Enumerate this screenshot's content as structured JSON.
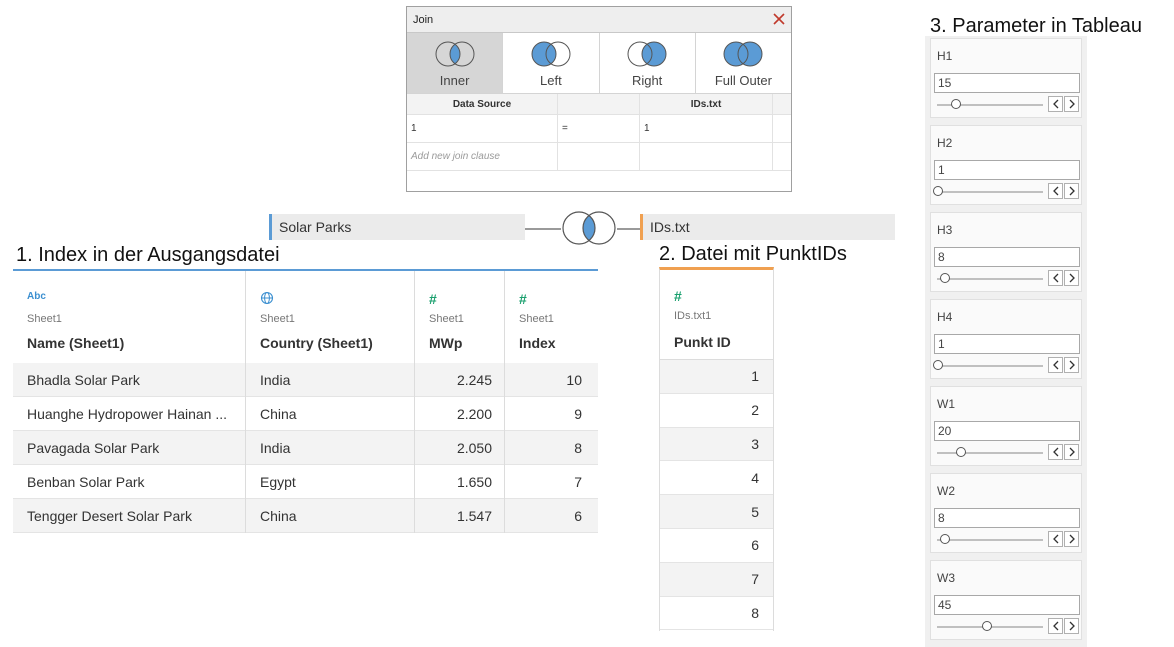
{
  "join_dialog": {
    "title": "Join",
    "types": [
      {
        "label": "Inner",
        "selected": true,
        "icon": "inner-join-icon"
      },
      {
        "label": "Left",
        "selected": false,
        "icon": "left-join-icon"
      },
      {
        "label": "Right",
        "selected": false,
        "icon": "right-join-icon"
      },
      {
        "label": "Full Outer",
        "selected": false,
        "icon": "full-outer-join-icon"
      }
    ],
    "clause_header": {
      "left": "Data Source",
      "right": "IDs.txt"
    },
    "clauses": [
      {
        "left": "1",
        "operator": "=",
        "right": "1"
      }
    ],
    "add_clause_placeholder": "Add new join clause"
  },
  "join_diagram": {
    "left_source": "Solar Parks",
    "right_source": "IDs.txt",
    "left_color": "#5b9bd5",
    "right_color": "#f0a050"
  },
  "headings": {
    "index": "1. Index in der Ausgangsdatei",
    "ids": "2. Datei mit PunktIDs",
    "params": "3. Parameter in Tableau"
  },
  "main_table": {
    "columns": [
      {
        "type_icon": "Abc",
        "source": "Sheet1",
        "name": "Name (Sheet1)"
      },
      {
        "type_icon": "globe",
        "source": "Sheet1",
        "name": "Country (Sheet1)"
      },
      {
        "type_icon": "#",
        "source": "Sheet1",
        "name": "MWp"
      },
      {
        "type_icon": "#",
        "source": "Sheet1",
        "name": "Index"
      }
    ],
    "rows": [
      [
        "Bhadla Solar Park",
        "India",
        "2.245",
        "10"
      ],
      [
        "Huanghe Hydropower Hainan ...",
        "China",
        "2.200",
        "9"
      ],
      [
        "Pavagada Solar Park",
        "India",
        "2.050",
        "8"
      ],
      [
        "Benban Solar Park",
        "Egypt",
        "1.650",
        "7"
      ],
      [
        "Tengger Desert Solar Park",
        "China",
        "1.547",
        "6"
      ]
    ]
  },
  "ids_table": {
    "type_icon": "#",
    "source": "IDs.txt1",
    "name": "Punkt ID",
    "values": [
      "1",
      "2",
      "3",
      "4",
      "5",
      "6",
      "7",
      "8"
    ]
  },
  "parameters": [
    {
      "label": "H1",
      "value": "15",
      "slider_fraction": 0.17
    },
    {
      "label": "H2",
      "value": "1",
      "slider_fraction": 0.0
    },
    {
      "label": "H3",
      "value": "8",
      "slider_fraction": 0.07
    },
    {
      "label": "H4",
      "value": "1",
      "slider_fraction": 0.0
    },
    {
      "label": "W1",
      "value": "20",
      "slider_fraction": 0.22
    },
    {
      "label": "W2",
      "value": "8",
      "slider_fraction": 0.07
    },
    {
      "label": "W3",
      "value": "45",
      "slider_fraction": 0.46
    }
  ]
}
